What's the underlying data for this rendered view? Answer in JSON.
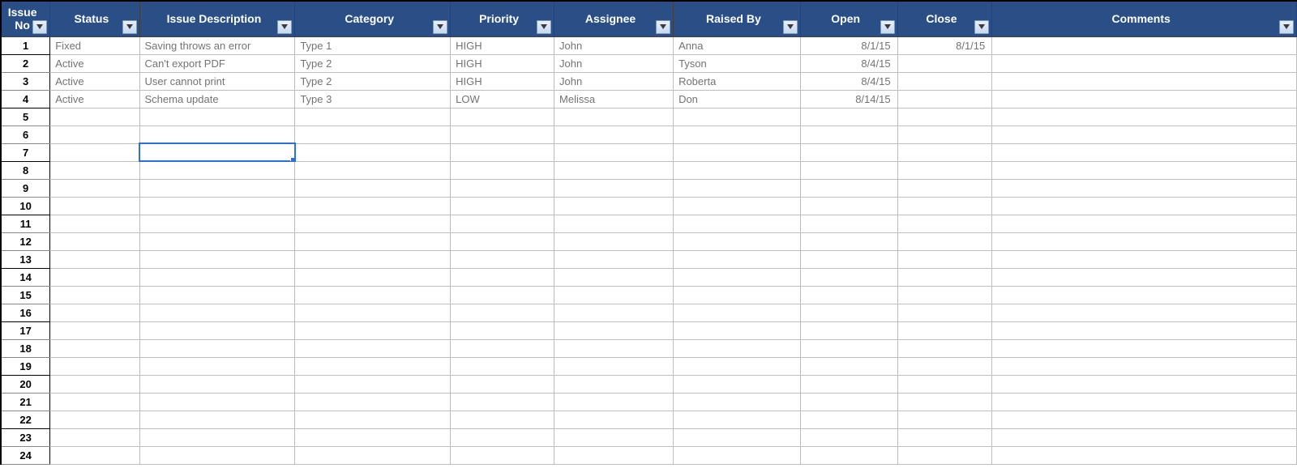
{
  "columns": [
    {
      "key": "issue_no",
      "label": "Issue No"
    },
    {
      "key": "status",
      "label": "Status"
    },
    {
      "key": "desc",
      "label": "Issue Description"
    },
    {
      "key": "category",
      "label": "Category"
    },
    {
      "key": "priority",
      "label": "Priority"
    },
    {
      "key": "assignee",
      "label": "Assignee"
    },
    {
      "key": "raised_by",
      "label": "Raised By"
    },
    {
      "key": "open",
      "label": "Open"
    },
    {
      "key": "close",
      "label": "Close"
    },
    {
      "key": "comments",
      "label": "Comments"
    }
  ],
  "rows": [
    {
      "issue_no": "1",
      "status": "Fixed",
      "desc": "Saving throws an error",
      "category": "Type 1",
      "priority": "HIGH",
      "assignee": "John",
      "raised_by": "Anna",
      "open": "8/1/15",
      "close": "8/1/15",
      "comments": ""
    },
    {
      "issue_no": "2",
      "status": "Active",
      "desc": "Can't export PDF",
      "category": "Type 2",
      "priority": "HIGH",
      "assignee": "John",
      "raised_by": "Tyson",
      "open": "8/4/15",
      "close": "",
      "comments": ""
    },
    {
      "issue_no": "3",
      "status": "Active",
      "desc": "User cannot print",
      "category": "Type 2",
      "priority": "HIGH",
      "assignee": "John",
      "raised_by": "Roberta",
      "open": "8/4/15",
      "close": "",
      "comments": ""
    },
    {
      "issue_no": "4",
      "status": "Active",
      "desc": "Schema update",
      "category": "Type 3",
      "priority": "LOW",
      "assignee": "Melissa",
      "raised_by": "Don",
      "open": "8/14/15",
      "close": "",
      "comments": ""
    },
    {
      "issue_no": "5"
    },
    {
      "issue_no": "6"
    },
    {
      "issue_no": "7"
    },
    {
      "issue_no": "8"
    },
    {
      "issue_no": "9"
    },
    {
      "issue_no": "10"
    },
    {
      "issue_no": "11"
    },
    {
      "issue_no": "12"
    },
    {
      "issue_no": "13"
    },
    {
      "issue_no": "14"
    },
    {
      "issue_no": "15"
    },
    {
      "issue_no": "16"
    },
    {
      "issue_no": "17"
    },
    {
      "issue_no": "18"
    },
    {
      "issue_no": "19"
    },
    {
      "issue_no": "20"
    },
    {
      "issue_no": "21"
    },
    {
      "issue_no": "22"
    },
    {
      "issue_no": "23"
    },
    {
      "issue_no": "24"
    }
  ],
  "selected_cell": {
    "row": 6,
    "col": "desc"
  }
}
